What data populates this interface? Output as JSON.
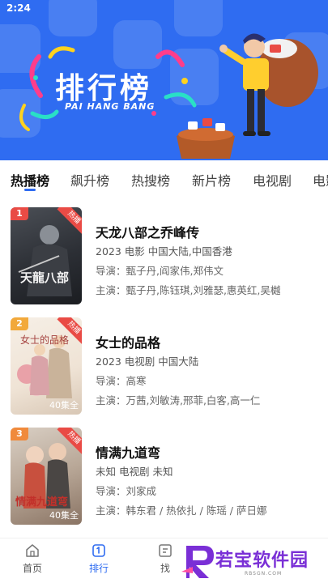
{
  "status_bar": {
    "time": "2:24"
  },
  "banner": {
    "title": "排行榜",
    "subtitle": "PAI HANG BANG"
  },
  "tabs": [
    {
      "label": "热播榜",
      "active": true
    },
    {
      "label": "飙升榜",
      "active": false
    },
    {
      "label": "热搜榜",
      "active": false
    },
    {
      "label": "新片榜",
      "active": false
    },
    {
      "label": "电视剧",
      "active": false
    },
    {
      "label": "电影",
      "active": false
    }
  ],
  "items": [
    {
      "rank": "1",
      "badge": "热播",
      "episodes": "",
      "title": "天龙八部之乔峰传",
      "meta": "2023  电影  中国大陆,中国香港",
      "director": "导演：甄子丹,阎家伟,郑伟文",
      "cast": "主演：甄子丹,陈钰琪,刘雅瑟,惠英红,吴樾",
      "rank_color": "#e94b45"
    },
    {
      "rank": "2",
      "badge": "热播",
      "episodes": "40集全",
      "title": "女士的品格",
      "meta": "2023  电视剧  中国大陆",
      "director": "导演：高寒",
      "cast": "主演：万茜,刘敏涛,邢菲,白客,高一仁",
      "rank_color": "#f2a93b"
    },
    {
      "rank": "3",
      "badge": "热播",
      "episodes": "40集全",
      "title": "情满九道弯",
      "meta": "未知  电视剧  未知",
      "director": "导演：刘家成",
      "cast": "主演：韩东君 / 热依扎 / 陈瑶 / 萨日娜",
      "rank_color": "#f08a3c"
    }
  ],
  "bottom_nav": [
    {
      "label": "首页",
      "icon": "home-icon",
      "active": false
    },
    {
      "label": "排行",
      "icon": "ranking-icon",
      "active": true
    },
    {
      "label": "找",
      "icon": "find-icon",
      "active": false
    }
  ],
  "watermark": {
    "text": "若宝软件园",
    "sub": "RBSGN.COM"
  },
  "colors": {
    "accent": "#2f6cf1",
    "hot": "#e94b45"
  }
}
